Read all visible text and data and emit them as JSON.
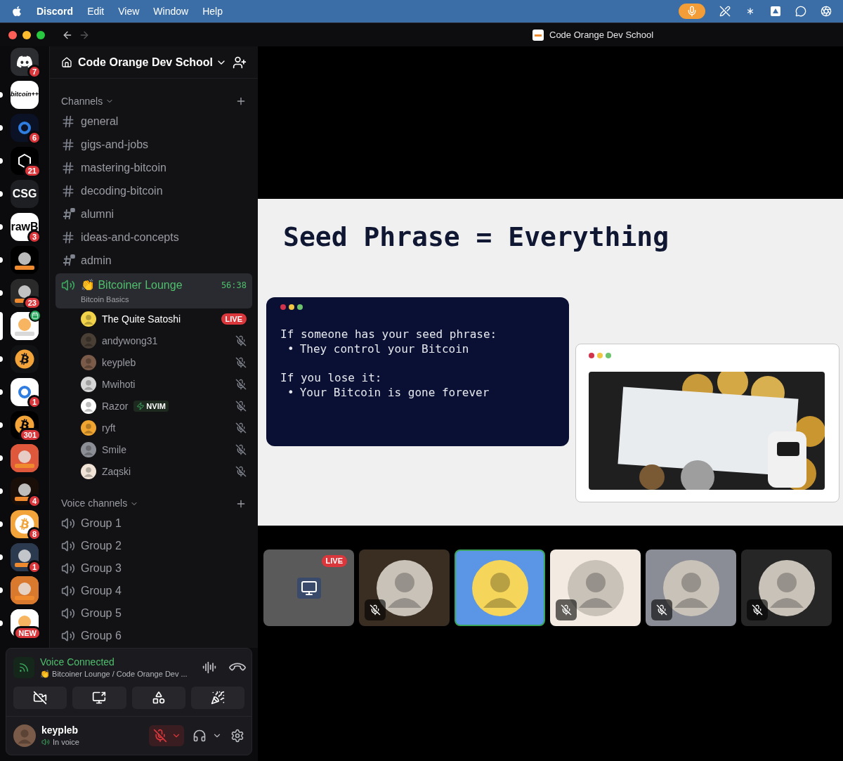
{
  "menu_bar": {
    "app_name": "Discord",
    "menus": [
      "Edit",
      "View",
      "Window",
      "Help"
    ],
    "mic_active": true
  },
  "window": {
    "title": "Code Orange Dev School"
  },
  "servers": [
    {
      "kind": "discord",
      "color": "#2b2d31",
      "badge": "7",
      "unread": false,
      "selected": false
    },
    {
      "kind": "text",
      "label": "bitcoin++",
      "color": "#ffffff",
      "unread": true,
      "selected": false
    },
    {
      "kind": "ring",
      "color": "#0b1226",
      "badge": "6",
      "unread": true,
      "selected": false
    },
    {
      "kind": "cube",
      "color": "#000000",
      "badge": "21",
      "unread": true,
      "selected": false
    },
    {
      "kind": "text",
      "label": "CSG",
      "color": "#1e1f22",
      "unread": true,
      "selected": false
    },
    {
      "kind": "text",
      "label": "rawB",
      "color": "#ffffff",
      "badge": "3",
      "unread": true,
      "selected": false
    },
    {
      "kind": "picture",
      "color": "#000000",
      "unread": true,
      "selected": false
    },
    {
      "kind": "picture",
      "color": "#2a2a2a",
      "badge": "23",
      "unread": true,
      "selected": false
    },
    {
      "kind": "picture",
      "color": "#ffffff",
      "event": true,
      "unread": false,
      "selected": true
    },
    {
      "kind": "bitcoin",
      "color": "#111214",
      "unread": true,
      "selected": false
    },
    {
      "kind": "ring",
      "color": "#ffffff",
      "badge": "1",
      "unread": true,
      "selected": false
    },
    {
      "kind": "bitcoin",
      "color": "#000000",
      "badge": "301",
      "unread": true,
      "selected": false
    },
    {
      "kind": "picture",
      "color": "#e0583b",
      "unread": true,
      "selected": false
    },
    {
      "kind": "picture",
      "color": "#1a0f08",
      "badge": "4",
      "unread": true,
      "selected": false
    },
    {
      "kind": "bitcoin",
      "color": "#f2a33a",
      "badge": "8",
      "unread": true,
      "selected": false
    },
    {
      "kind": "picture",
      "color": "#2c3a4f",
      "badge": "1",
      "unread": true,
      "selected": false
    },
    {
      "kind": "picture",
      "color": "#d9792d",
      "unread": true,
      "selected": false
    },
    {
      "kind": "picture",
      "color": "#ffffff",
      "badge": "NEW",
      "unread": true,
      "selected": false
    }
  ],
  "server": {
    "name": "Code Orange Dev School"
  },
  "channels_header": "Channels",
  "channels": [
    {
      "name": "general",
      "locked": false
    },
    {
      "name": "gigs-and-jobs",
      "locked": false
    },
    {
      "name": "mastering-bitcoin",
      "locked": false
    },
    {
      "name": "decoding-bitcoin",
      "locked": false
    },
    {
      "name": "alumni",
      "locked": true
    },
    {
      "name": "ideas-and-concepts",
      "locked": false
    },
    {
      "name": "admin",
      "locked": true
    }
  ],
  "active_voice": {
    "name": "👏 Bitcoiner Lounge",
    "timer": "56:38",
    "topic": "Bitcoin Basics"
  },
  "members": [
    {
      "name": "The Quite Satoshi",
      "color": "#f2d34a",
      "live": "LIVE",
      "muted": false
    },
    {
      "name": "andywong31",
      "color": "#4a3f35",
      "muted": true
    },
    {
      "name": "keypleb",
      "color": "#7a5a48",
      "muted": true
    },
    {
      "name": "Mwihoti",
      "color": "#d7d7d7",
      "muted": true
    },
    {
      "name": "Razor",
      "color": "#ffffff",
      "tag": "NVIM",
      "muted": true
    },
    {
      "name": "ryft",
      "color": "#f0a530",
      "muted": true
    },
    {
      "name": "Smile",
      "color": "#8c8f96",
      "muted": true
    },
    {
      "name": "Zaqski",
      "color": "#f1e4d6",
      "muted": true
    }
  ],
  "voice_header": "Voice channels",
  "voice_channels": [
    "Group 1",
    "Group 2",
    "Group 3",
    "Group 4",
    "Group 5",
    "Group 6"
  ],
  "voice_panel": {
    "status": "Voice Connected",
    "location": "👏 Bitcoiner Lounge / Code Orange Dev ..."
  },
  "user": {
    "name": "keypleb",
    "status": "In voice",
    "mic_muted": true
  },
  "slide": {
    "title": "Seed Phrase = Everything",
    "blocks": [
      {
        "heading": "If someone has your seed phrase:",
        "points": [
          "They control your Bitcoin"
        ]
      },
      {
        "heading": "If you lose it:",
        "points": [
          "Your Bitcoin is gone forever"
        ]
      }
    ],
    "bullet": "•",
    "photo": {
      "kind": "picture"
    }
  },
  "tiles": [
    {
      "kind": "stream",
      "live": "LIVE",
      "color": "#5a5a5a",
      "muted": false,
      "speaking": false
    },
    {
      "kind": "user",
      "color": "#3a2e22",
      "muted": true,
      "speaking": false
    },
    {
      "kind": "user",
      "color": "#5b95e6",
      "muted": false,
      "speaking": true
    },
    {
      "kind": "user",
      "color": "#f3ebe2",
      "muted": true,
      "speaking": false
    },
    {
      "kind": "user",
      "color": "#8a8d95",
      "muted": true,
      "speaking": false
    },
    {
      "kind": "user",
      "color": "#262626",
      "muted": true,
      "speaking": false
    }
  ]
}
